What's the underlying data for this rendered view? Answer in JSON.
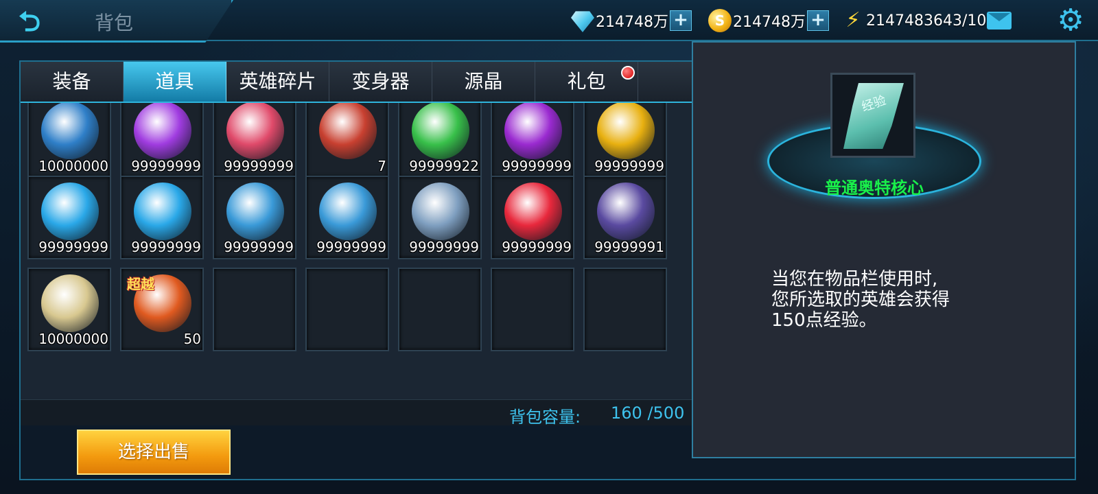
{
  "header": {
    "title": "背包",
    "diamonds": "214748万",
    "gold": "214748万",
    "energy": "2147483643/100"
  },
  "tabs": [
    {
      "label": "装备",
      "active": false
    },
    {
      "label": "道具",
      "active": true
    },
    {
      "label": "英雄碎片",
      "active": false
    },
    {
      "label": "变身器",
      "active": false
    },
    {
      "label": "源晶",
      "active": false
    },
    {
      "label": "礼包",
      "active": false,
      "badge": true
    }
  ],
  "items": [
    {
      "count": "10000000",
      "icon": "blue-orb-icon",
      "color": "#2f7fc8"
    },
    {
      "count": "99999999",
      "icon": "purple-scroll-icon",
      "color": "#a03ce0"
    },
    {
      "count": "99999999",
      "icon": "red-crystal-icon",
      "color": "#e04a6a"
    },
    {
      "count": "7",
      "icon": "hero-fragment-icon",
      "color": "#c84030"
    },
    {
      "count": "99999922",
      "icon": "green-gem-icon",
      "color": "#38c04a"
    },
    {
      "count": "99999999",
      "icon": "purple-gem-icon",
      "color": "#9a2ad0"
    },
    {
      "count": "99999999",
      "icon": "gold-gem-icon",
      "color": "#e8b010"
    },
    {
      "count": "99999999",
      "icon": "blue-core-icon",
      "color": "#2aa8e8"
    },
    {
      "count": "99999999",
      "icon": "blue-core-icon",
      "color": "#2aa8e8"
    },
    {
      "count": "99999999",
      "icon": "blue-core-icon",
      "color": "#3a9ad8"
    },
    {
      "count": "99999999",
      "icon": "blue-core-icon",
      "color": "#3a9ad8"
    },
    {
      "count": "99999999",
      "icon": "star-badge-icon",
      "color": "#7f9fc0"
    },
    {
      "count": "99999999",
      "icon": "red-crystal-icon",
      "color": "#e8283c"
    },
    {
      "count": "99999991",
      "icon": "dark-crystal-icon",
      "color": "#5a4aa0"
    },
    {
      "count": "10000000",
      "icon": "light-orb-icon",
      "color": "#d8c890"
    },
    {
      "count": "50",
      "icon": "hero-fragment-icon",
      "color": "#e05a20",
      "tag": "超越"
    }
  ],
  "capacity": {
    "label": "背包容量:",
    "value": "160 /500"
  },
  "sell_button": "选择出售",
  "detail": {
    "chip_label": "经验",
    "name": "普通奥特核心",
    "desc_lines": [
      "当您在物品栏使用时,",
      "您所选取的英雄会获得",
      "150点经验。"
    ]
  },
  "colors": {
    "accent": "#3ec3ee",
    "item_name": "#19f04a",
    "sell": "#f39a0e"
  }
}
